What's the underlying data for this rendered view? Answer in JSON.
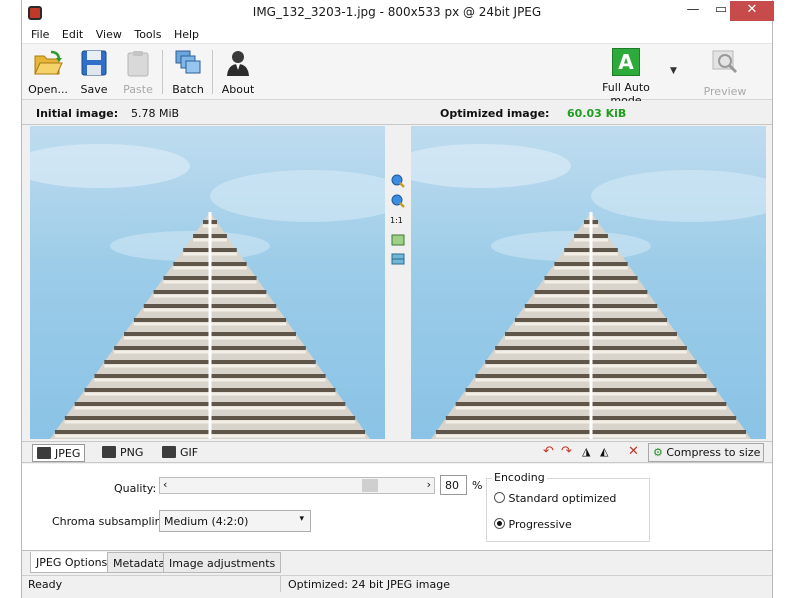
{
  "window": {
    "title": "IMG_132_3203-1.jpg - 800x533 px @ 24bit JPEG"
  },
  "window_controls": {
    "minimize": "—",
    "restore": "▭",
    "close": "✕"
  },
  "menu": [
    "File",
    "Edit",
    "View",
    "Tools",
    "Help"
  ],
  "toolbar": {
    "open": "Open...",
    "save": "Save",
    "paste": "Paste",
    "batch": "Batch",
    "about": "About",
    "mode_letter": "A",
    "mode": "Full Auto mode",
    "preview": "Preview"
  },
  "info": {
    "initial_label": "Initial image:",
    "initial_size": "5.78 MiB",
    "optimized_label": "Optimized image:",
    "optimized_size": "60.03 KiB",
    "optimized_color": "#1e9e1e"
  },
  "zoom": {
    "one_to_one": "1:1"
  },
  "format_tabs": [
    "JPEG",
    "PNG",
    "GIF"
  ],
  "compress_to_size": "Compress to size",
  "options": {
    "quality_label": "Quality:",
    "quality_value": "80",
    "quality_unit": "%",
    "quality_fraction": 0.8,
    "chroma_label": "Chroma subsampling:",
    "chroma_value": "Medium (4:2:0)",
    "encoding_title": "Encoding",
    "encoding_standard": "Standard optimized",
    "encoding_progressive": "Progressive",
    "encoding_selected": "Progressive"
  },
  "bottom_tabs": [
    "JPEG Options",
    "Metadata",
    "Image adjustments"
  ],
  "status": {
    "left": "Ready",
    "middle": "Optimized: 24 bit JPEG image"
  },
  "colors": {
    "accent_green": "#2cab3a",
    "close_red": "#c74b4b"
  }
}
